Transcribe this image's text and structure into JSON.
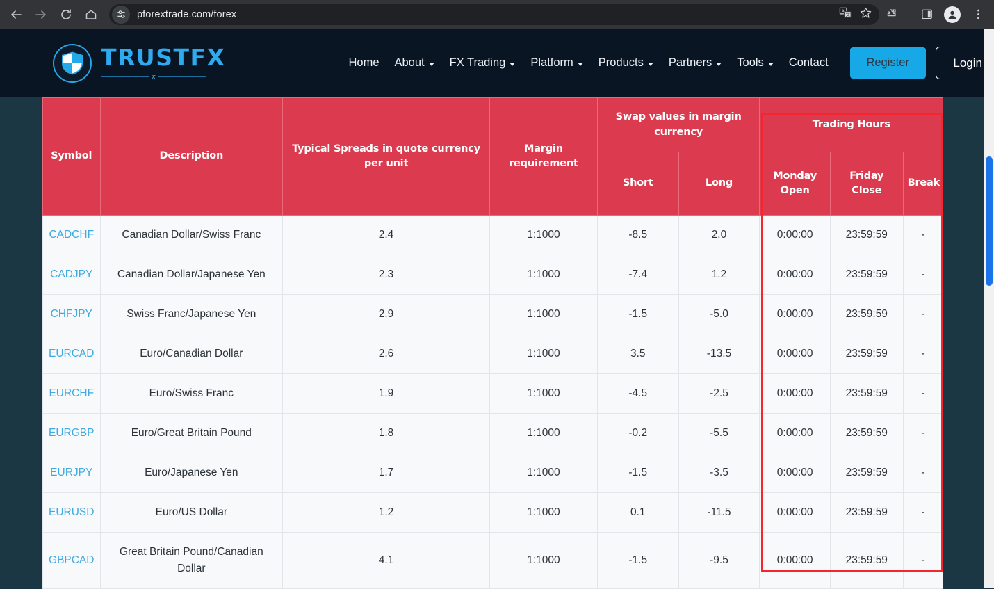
{
  "browser": {
    "back_icon": "back-arrow-icon",
    "forward_icon": "forward-arrow-icon",
    "reload_icon": "reload-icon",
    "home_icon": "home-icon",
    "site_settings_icon": "site-settings-sliders-icon",
    "url": "pforextrade.com/forex",
    "translate_icon": "translate-icon",
    "bookmark_icon": "star-bookmark-icon",
    "extensions_icon": "extensions-puzzle-icon",
    "side_panel_icon": "side-panel-icon",
    "profile_icon": "profile-avatar-icon",
    "menu_icon": "three-dot-menu-icon"
  },
  "site": {
    "brand": "TRUSTFX",
    "brand_rule_mark": "x",
    "logo_icon": "shield-logo-icon",
    "nav": [
      {
        "label": "Home",
        "has_caret": false
      },
      {
        "label": "About",
        "has_caret": true
      },
      {
        "label": "FX Trading",
        "has_caret": true
      },
      {
        "label": "Platform",
        "has_caret": true
      },
      {
        "label": "Products",
        "has_caret": true
      },
      {
        "label": "Partners",
        "has_caret": true
      },
      {
        "label": "Tools",
        "has_caret": true
      },
      {
        "label": "Contact",
        "has_caret": false
      }
    ],
    "register_label": "Register",
    "login_label": "Login",
    "colors": {
      "header_bg": "#0a1523",
      "page_bg": "#1c3744",
      "brand_blue": "#2eaaf0",
      "register_bg": "#17a8e8",
      "table_header_red": "#dc3a4e",
      "symbol_link": "#3eaae0",
      "annotation_red": "#f5262d",
      "scrollbar_thumb": "#1a73e8"
    }
  },
  "table": {
    "headers": {
      "symbol": "Symbol",
      "description": "Description",
      "spreads": "Typical Spreads in quote currency per unit",
      "margin": "Margin requirement",
      "swap_group": "Swap values in margin currency",
      "swap_short": "Short",
      "swap_long": "Long",
      "hours_group": "Trading Hours",
      "monday_open": "Monday Open",
      "friday_close": "Friday Close",
      "break": "Break"
    },
    "rows": [
      {
        "symbol": "CADCHF",
        "description": "Canadian Dollar/Swiss Franc",
        "spread": "2.4",
        "margin": "1:1000",
        "short": "-8.5",
        "long": "2.0",
        "monday_open": "0:00:00",
        "friday_close": "23:59:59",
        "break": "-"
      },
      {
        "symbol": "CADJPY",
        "description": "Canadian Dollar/Japanese Yen",
        "spread": "2.3",
        "margin": "1:1000",
        "short": "-7.4",
        "long": "1.2",
        "monday_open": "0:00:00",
        "friday_close": "23:59:59",
        "break": "-"
      },
      {
        "symbol": "CHFJPY",
        "description": "Swiss Franc/Japanese Yen",
        "spread": "2.9",
        "margin": "1:1000",
        "short": "-1.5",
        "long": "-5.0",
        "monday_open": "0:00:00",
        "friday_close": "23:59:59",
        "break": "-"
      },
      {
        "symbol": "EURCAD",
        "description": "Euro/Canadian Dollar",
        "spread": "2.6",
        "margin": "1:1000",
        "short": "3.5",
        "long": "-13.5",
        "monday_open": "0:00:00",
        "friday_close": "23:59:59",
        "break": "-"
      },
      {
        "symbol": "EURCHF",
        "description": "Euro/Swiss Franc",
        "spread": "1.9",
        "margin": "1:1000",
        "short": "-4.5",
        "long": "-2.5",
        "monday_open": "0:00:00",
        "friday_close": "23:59:59",
        "break": "-"
      },
      {
        "symbol": "EURGBP",
        "description": "Euro/Great Britain Pound",
        "spread": "1.8",
        "margin": "1:1000",
        "short": "-0.2",
        "long": "-5.5",
        "monday_open": "0:00:00",
        "friday_close": "23:59:59",
        "break": "-"
      },
      {
        "symbol": "EURJPY",
        "description": "Euro/Japanese Yen",
        "spread": "1.7",
        "margin": "1:1000",
        "short": "-1.5",
        "long": "-3.5",
        "monday_open": "0:00:00",
        "friday_close": "23:59:59",
        "break": "-"
      },
      {
        "symbol": "EURUSD",
        "description": "Euro/US Dollar",
        "spread": "1.2",
        "margin": "1:1000",
        "short": "0.1",
        "long": "-11.5",
        "monday_open": "0:00:00",
        "friday_close": "23:59:59",
        "break": "-"
      },
      {
        "symbol": "GBPCAD",
        "description": "Great Britain Pound/Canadian Dollar",
        "spread": "4.1",
        "margin": "1:1000",
        "short": "-1.5",
        "long": "-9.5",
        "monday_open": "0:00:00",
        "friday_close": "23:59:59",
        "break": "-"
      }
    ]
  }
}
